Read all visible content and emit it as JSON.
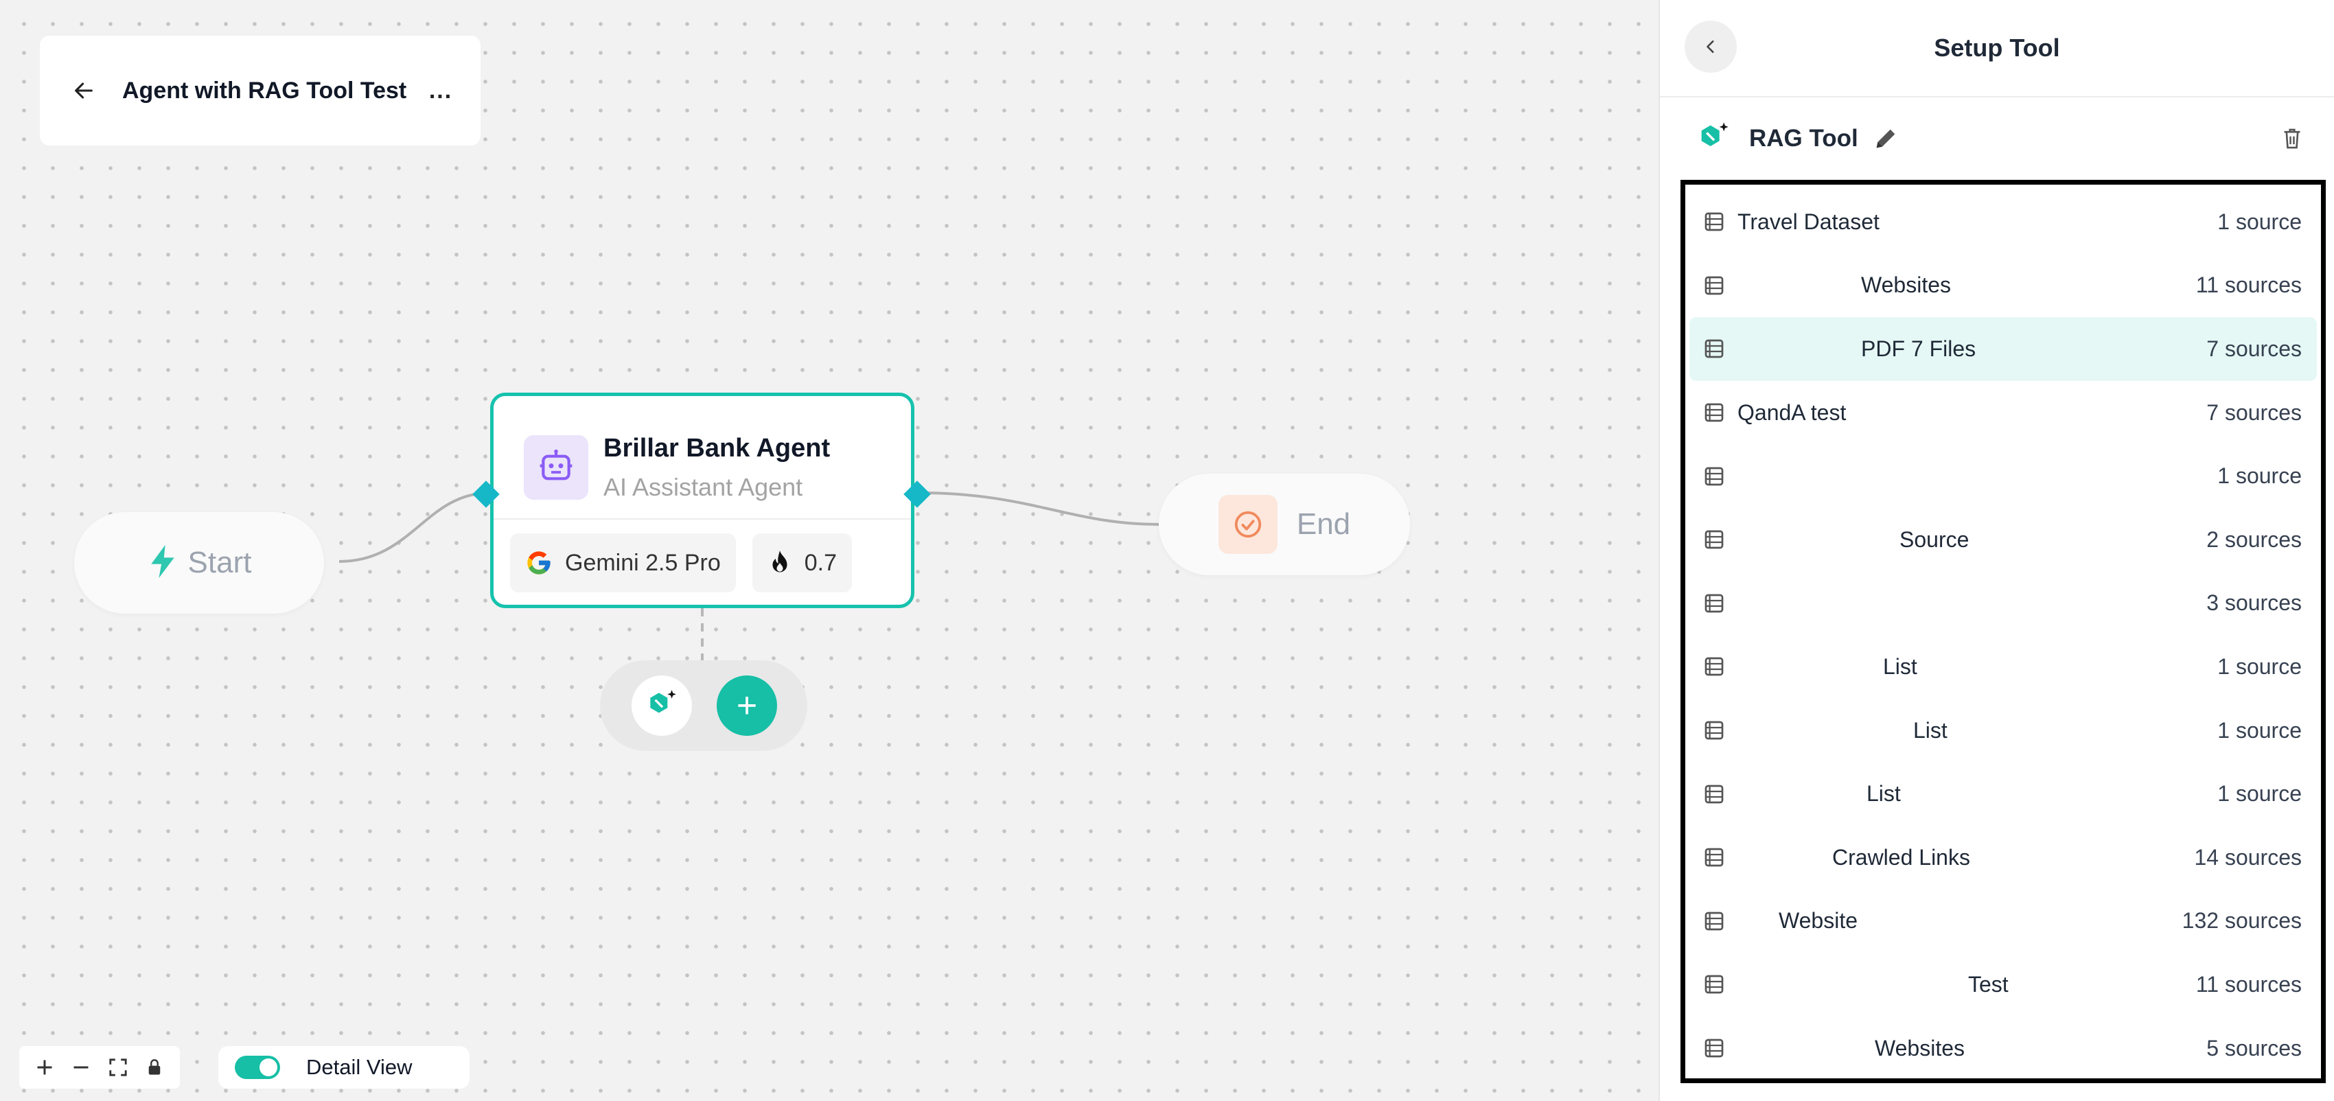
{
  "flow": {
    "title": "Agent with RAG Tool Test",
    "more_label": "...",
    "start_label": "Start",
    "end_label": "End",
    "agent": {
      "name": "Brillar Bank Agent",
      "subtitle": "AI Assistant Agent",
      "model": "Gemini 2.5 Pro",
      "temperature": "0.7"
    },
    "add_label": "+",
    "detail_view_label": "Detail View",
    "detail_view_on": true
  },
  "panel": {
    "title": "Setup Tool",
    "tool_name": "RAG Tool",
    "datasets": [
      {
        "name": "Travel Dataset",
        "count": "1 source",
        "indent": 0
      },
      {
        "name": "Websites",
        "count": "11 sources",
        "indent": 180
      },
      {
        "name": "PDF 7 Files",
        "count": "7 sources",
        "indent": 180,
        "selected": true
      },
      {
        "name": "QandA test",
        "count": "7 sources",
        "indent": 0
      },
      {
        "name": "",
        "count": "1 source",
        "indent": 0
      },
      {
        "name": "Source",
        "count": "2 sources",
        "indent": 236
      },
      {
        "name": "",
        "count": "3 sources",
        "indent": 0
      },
      {
        "name": "List",
        "count": "1 source",
        "indent": 212
      },
      {
        "name": "List",
        "count": "1 source",
        "indent": 256
      },
      {
        "name": "List",
        "count": "1 source",
        "indent": 188
      },
      {
        "name": "Crawled Links",
        "count": "14 sources",
        "indent": 138
      },
      {
        "name": "Website",
        "count": "132 sources",
        "indent": 60
      },
      {
        "name": "Test",
        "count": "11 sources",
        "indent": 336
      },
      {
        "name": "Websites",
        "count": "5 sources",
        "indent": 200
      }
    ]
  },
  "colors": {
    "accent": "#16bfa6",
    "handle": "#16b8c8",
    "selected_row": "#e5f8f5",
    "end_badge": "#fde7dc",
    "agent_badge": "#ebe4fb"
  },
  "icons": [
    "back-arrow-icon",
    "more-icon",
    "bolt-icon",
    "robot-icon",
    "google-icon",
    "flame-icon",
    "check-circle-icon",
    "rag-tool-icon",
    "plus-icon",
    "minus-icon",
    "fit-view-icon",
    "lock-icon",
    "chevron-left-icon",
    "pencil-icon",
    "trash-icon",
    "dataset-icon"
  ]
}
